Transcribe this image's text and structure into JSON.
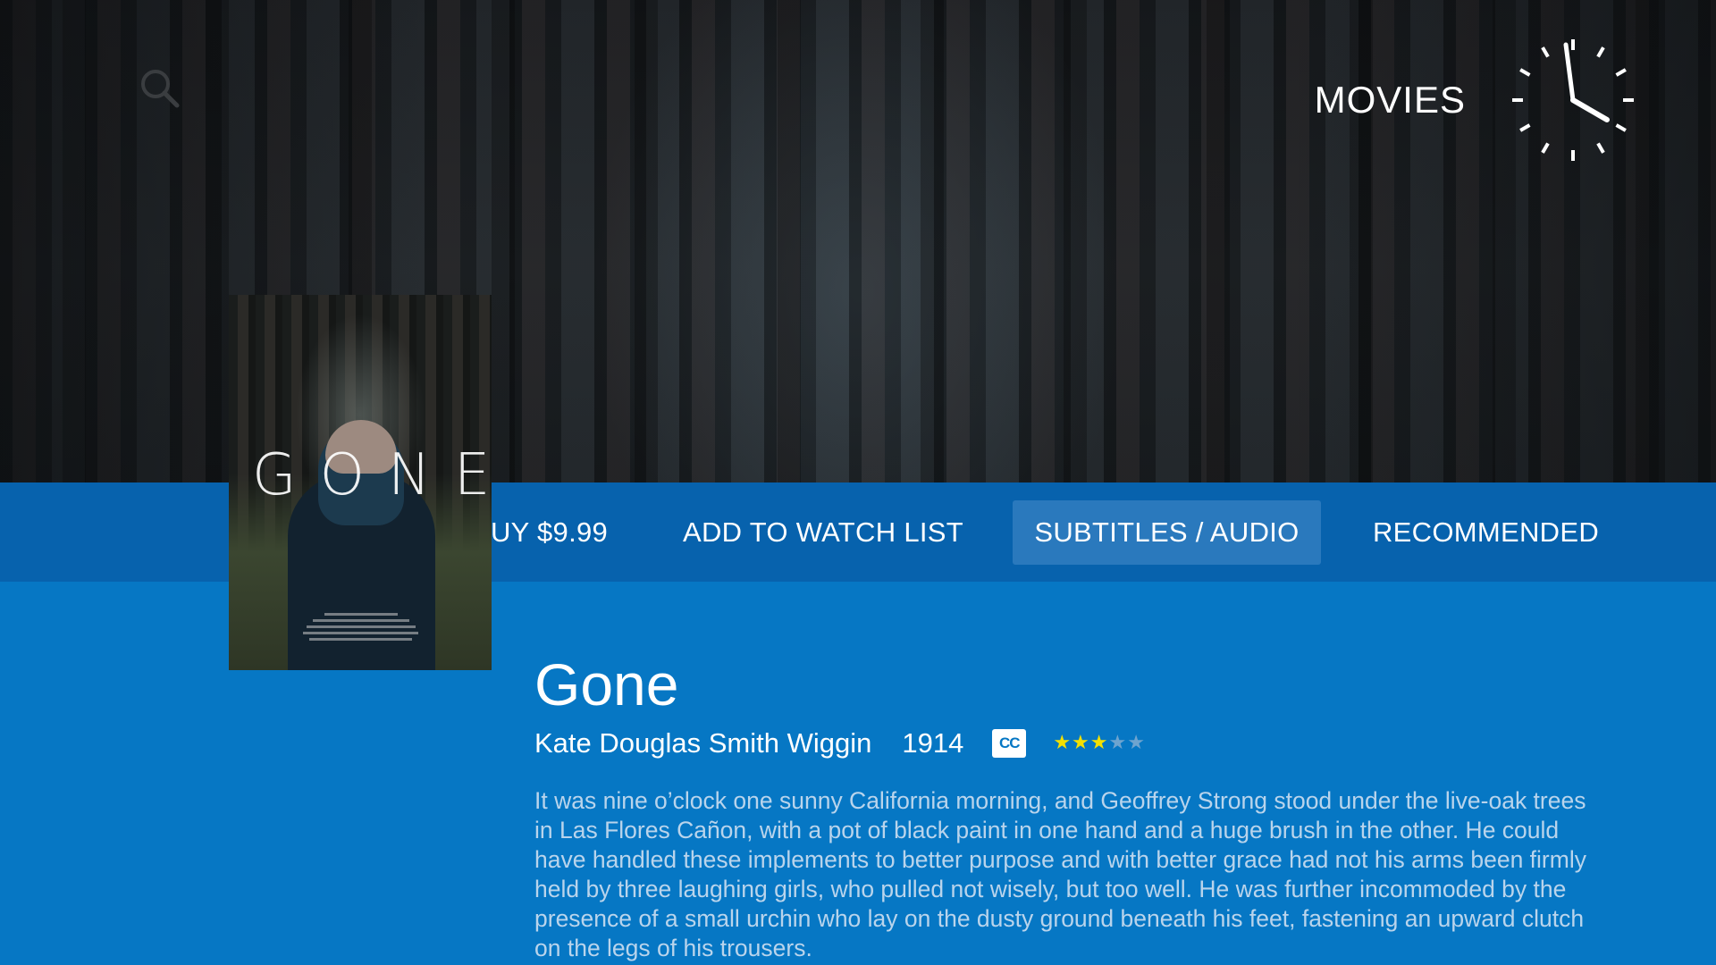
{
  "header": {
    "section_title": "MOVIES",
    "search_icon": "search-icon",
    "clock_icon": "clock-icon"
  },
  "actions": {
    "buy_label": "UY $9.99",
    "watchlist_label": "ADD TO WATCH LIST",
    "subtitles_label": "SUBTITLES / AUDIO",
    "recommended_label": "RECOMMENDED",
    "selected": "SUBTITLES / AUDIO"
  },
  "poster": {
    "title_text": "GONE"
  },
  "movie": {
    "title": "Gone",
    "director": "Kate Douglas Smith Wiggin",
    "year": "1914",
    "cc_label": "CC",
    "rating": 3,
    "rating_max": 5,
    "description": "It was nine o’clock one sunny California morning, and Geoffrey Strong stood under the live-oak trees in Las Flores Cañon, with a pot of black paint in one hand and a huge brush in the other.  He could have handled these implements to better purpose and with better grace had not his arms been firmly held by three laughing girls, who pulled not wisely, but too well.  He was further incommoded by the presence of a small urchin who lay on the dusty ground beneath his feet, fastening an upward clutch on the legs of his trousers."
  },
  "colors": {
    "background": "#0677c4",
    "action_bar": "#0762ad",
    "action_selected": "#2a79bd",
    "star_on": "#f3e000",
    "star_off": "#6ea4cf",
    "description_text": "#b9d4ec"
  }
}
